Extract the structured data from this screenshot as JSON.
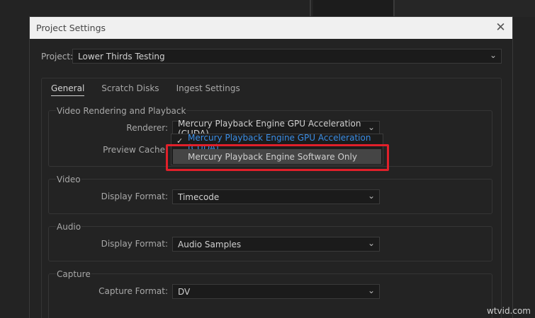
{
  "dialog": {
    "title": "Project Settings",
    "close_glyph": "✕"
  },
  "project": {
    "label": "Project:",
    "value": "Lower Thirds Testing"
  },
  "tabs": [
    {
      "label": "General",
      "active": true
    },
    {
      "label": "Scratch Disks",
      "active": false
    },
    {
      "label": "Ingest Settings",
      "active": false
    }
  ],
  "video_rendering": {
    "title": "Video Rendering and Playback",
    "renderer_label": "Renderer:",
    "renderer_value": "Mercury Playback Engine GPU Acceleration (CUDA)",
    "preview_cache_label": "Preview Cache:"
  },
  "renderer_dropdown": {
    "options": [
      {
        "label": "Mercury Playback Engine GPU Acceleration (CUDA)",
        "checked": true
      },
      {
        "label": "Mercury Playback Engine Software Only",
        "checked": false
      }
    ]
  },
  "video": {
    "title": "Video",
    "display_format_label": "Display Format:",
    "display_format_value": "Timecode"
  },
  "audio": {
    "title": "Audio",
    "display_format_label": "Display Format:",
    "display_format_value": "Audio Samples"
  },
  "capture": {
    "title": "Capture",
    "capture_format_label": "Capture Format:",
    "capture_format_value": "DV"
  },
  "watermark": "wtvid.com",
  "colors": {
    "accent": "#3a8ee6",
    "highlight": "#e0202a",
    "titlebar": "#f0f0f0"
  },
  "icons": {
    "check": "check-icon",
    "chevron": "chevron-down-icon",
    "close": "close-icon"
  }
}
